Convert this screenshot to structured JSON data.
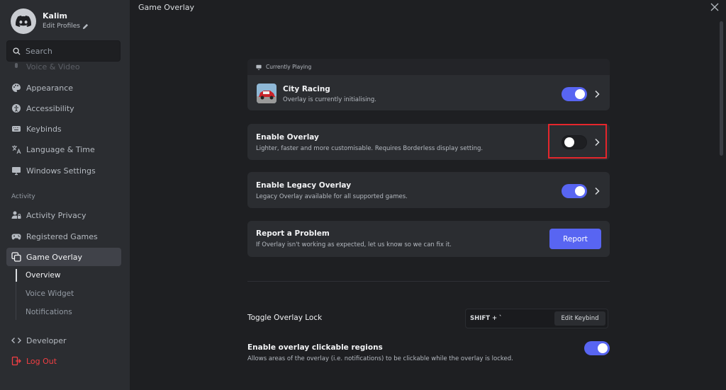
{
  "profile": {
    "name": "Kalim",
    "edit_label": "Edit Profiles"
  },
  "search": {
    "placeholder": "Search"
  },
  "sidebar": {
    "partial_item": "Voice & Video",
    "items": [
      {
        "label": "Appearance",
        "icon": "palette-icon"
      },
      {
        "label": "Accessibility",
        "icon": "accessibility-icon"
      },
      {
        "label": "Keybinds",
        "icon": "keyboard-icon"
      },
      {
        "label": "Language & Time",
        "icon": "translate-icon"
      },
      {
        "label": "Windows Settings",
        "icon": "monitor-icon"
      }
    ],
    "section_activity": "Activity",
    "activity_items": [
      {
        "label": "Activity Privacy",
        "icon": "person-lock-icon"
      },
      {
        "label": "Registered Games",
        "icon": "gamepad-icon"
      },
      {
        "label": "Game Overlay",
        "icon": "overlay-icon"
      }
    ],
    "sub_items": [
      "Overview",
      "Voice Widget",
      "Notifications"
    ],
    "developer": "Developer",
    "logout": "Log Out"
  },
  "header": {
    "title": "Game Overlay"
  },
  "currently_playing": {
    "head": "Currently Playing",
    "game": "City Racing",
    "status": "Overlay is currently initialising."
  },
  "enable_overlay": {
    "title": "Enable Overlay",
    "desc": "Lighter, faster and more customisable. Requires Borderless display setting."
  },
  "legacy_overlay": {
    "title": "Enable Legacy Overlay",
    "desc": "Legacy Overlay available for all supported games."
  },
  "report": {
    "title": "Report a Problem",
    "desc": "If Overlay isn't working as expected, let us know so we can fix it.",
    "button": "Report"
  },
  "toggle_lock": {
    "title": "Toggle Overlay Lock",
    "keybind": "SHIFT + `",
    "edit_button": "Edit Keybind"
  },
  "clickable_regions": {
    "title": "Enable overlay clickable regions",
    "desc": "Allows areas of the overlay (i.e. notifications) to be clickable while the overlay is locked."
  },
  "colors": {
    "accent": "#5865f2",
    "highlight": "#e5262c",
    "danger": "#f23f43"
  }
}
